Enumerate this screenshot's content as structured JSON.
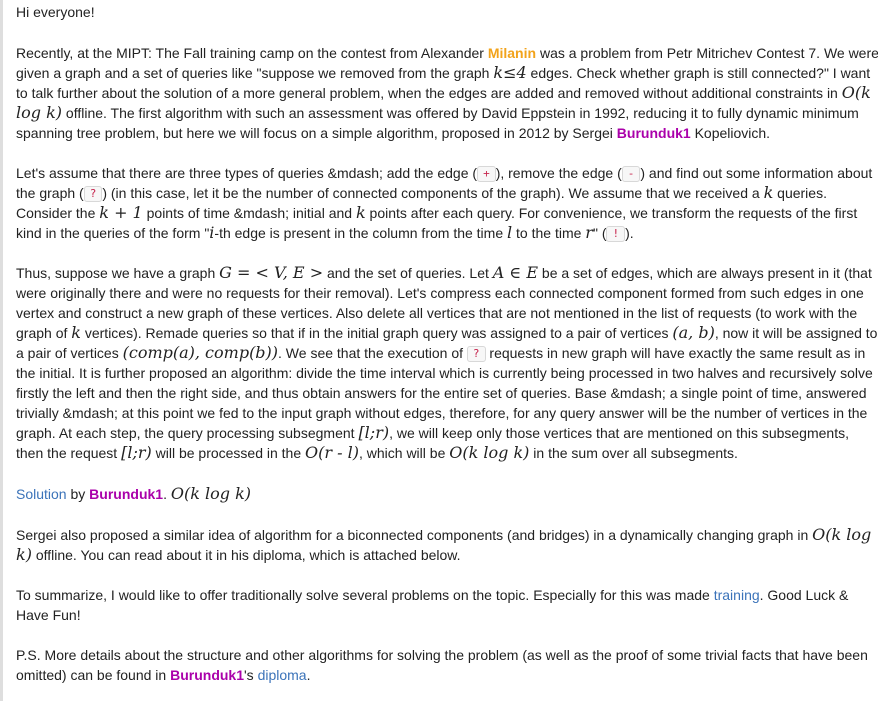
{
  "p1": "Hi everyone!",
  "p2": {
    "t1": "Recently, at the MIPT: The Fall training camp on the contest from Alexander ",
    "user1": "Milanin",
    "t2": " was a problem from Petr Mitrichev Contest 7. We were given a graph and a set of queries like \"suppose we removed from the graph ",
    "m1": "k≤4",
    "t3": " edges. Check whether graph is still connected?\" I want to talk further about the solution of a more general problem, when the edges are added and removed without additional constraints in ",
    "m2": "O(k log k)",
    "t4": " offline. The first algorithm with such an assessment was offered by David Eppstein in 1992, reducing it to fully dynamic minimum spanning tree problem, but here we will focus on a simple algorithm, proposed in 2012 by Sergei ",
    "user2": "Burunduk1",
    "t5": " Kopeliovich."
  },
  "p3": {
    "t1": "Let's assume that there are three types of queries &mdash; add the edge (",
    "c1": "+",
    "t2": "), remove the edge (",
    "c2": "-",
    "t3": ") and find out some information about the graph (",
    "c3": "?",
    "t4": ") (in this case, let it be the number of connected components of the graph). We assume that we received a ",
    "m1": "k",
    "t5": " queries. Consider the ",
    "m2": "k + 1",
    "t6": " points of time &mdash; initial and ",
    "m3": "k",
    "t7": " points after each query. For convenience, we transform the requests of the first kind in the queries of the form \"",
    "m4": "i",
    "t8": "-th edge is present in the column from the time ",
    "m5": "l",
    "t9": " to the time ",
    "m6": "r",
    "t10": "\" (",
    "c4": "!",
    "t11": ")."
  },
  "p4": {
    "t1": "Thus, suppose we have a graph ",
    "m1": "G = < V, E >",
    "t2": " and the set of queries. Let ",
    "m2": "A ∈ E",
    "t3": " be a set of edges, which are always present in it (that were originally there and were no requests for their removal). Let's compress each connected component formed from such edges in one vertex and construct a new graph of these vertices. Also delete all vertices that are not mentioned in the list of requests (to work with the graph of ",
    "m3": "k",
    "t4": " vertices). Remade queries so that if in the initial graph query was assigned to a pair of vertices ",
    "m4": "(a, b)",
    "t5": ", now it will be assigned to a pair of vertices ",
    "m5": "(comp(a), comp(b))",
    "t6": ". We see that the execution of ",
    "c1": "?",
    "t7": " requests in new graph will have exactly the same result as in the initial. It is further proposed an algorithm: divide the time interval which is currently being processed in two halves and recursively solve firstly the left and then the right side, and thus obtain answers for the entire set of queries. Base &mdash; a single point of time, answered trivially &mdash; at this point we fed to the input graph without edges, therefore, for any query answer will be the number of vertices in the graph. At each step, the query processing subsegment ",
    "m6": "[l;r)",
    "t8": ", we will keep only those vertices that are mentioned on this subsegments, then the request ",
    "m7": "[l;r)",
    "t9": " will be processed in the ",
    "m8": "O(r - l)",
    "t10": ", which will be ",
    "m9": "O(k log k)",
    "t11": " in the sum over all subsegments."
  },
  "p5": {
    "link": "Solution",
    "t1": " by ",
    "user": "Burunduk1",
    "t2": ". ",
    "m1": "O(k log k)"
  },
  "p6": {
    "t1": "Sergei also proposed a similar idea of algorithm for a biconnected components (and bridges) in a dynamically changing graph in ",
    "m1": "O(k log k)",
    "t2": " offline. You can read about it in his diploma, which is attached below."
  },
  "p7": {
    "t1": "To summarize, I would like to offer traditionally solve several problems on the topic. Especially for this was made ",
    "link": "training",
    "t2": ". Good Luck & Have Fun!"
  },
  "p8": {
    "t1": "P.S. More details about the structure and other algorithms for solving the problem (as well as the proof of some trivial facts that have been omitted) can be found in ",
    "user": "Burunduk1",
    "t2": "'s ",
    "link": "diploma",
    "t3": "."
  },
  "colors": {
    "orange_user": "#f2a31b",
    "purple_user": "#aa00aa",
    "link": "#3b73b9",
    "code_text": "#c7254e"
  }
}
